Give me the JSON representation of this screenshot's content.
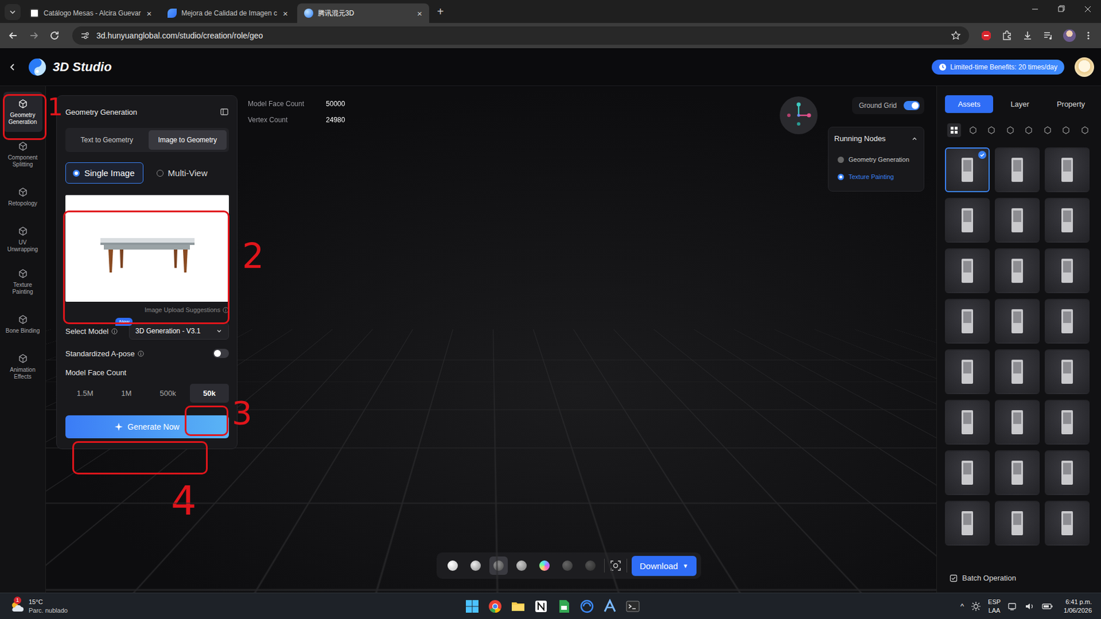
{
  "browser": {
    "tabs": [
      {
        "title": "Catálogo Mesas - Alcira Guevar",
        "close": "×",
        "selected": false
      },
      {
        "title": "Mejora de Calidad de Imagen c",
        "close": "×",
        "selected": false
      },
      {
        "title": "腾讯混元3D",
        "close": "×",
        "selected": true
      }
    ],
    "new_tab": "+",
    "url": "3d.hunyuanglobal.com/studio/creation/role/geo"
  },
  "app": {
    "title": "3D Studio",
    "benefit": "Limited-time Benefits: 20 times/day"
  },
  "tools": [
    {
      "label": "Geometry Generation",
      "selected": true
    },
    {
      "label": "Component Splitting",
      "selected": false
    },
    {
      "label": "Retopology",
      "selected": false
    },
    {
      "label": "UV Unwrapping",
      "selected": false
    },
    {
      "label": "Texture Painting",
      "selected": false
    },
    {
      "label": "Bone Binding",
      "selected": false
    },
    {
      "label": "Animation Effects",
      "selected": false
    }
  ],
  "panel": {
    "title": "Geometry Generation",
    "modes": [
      {
        "label": "Text to Geometry",
        "selected": false
      },
      {
        "label": "Image to Geometry",
        "selected": true
      }
    ],
    "inputs": [
      {
        "label": "Single Image",
        "selected": true
      },
      {
        "label": "Multi-View",
        "selected": false
      }
    ],
    "upload_hint": "Image Upload Suggestions",
    "model": {
      "label": "Select Model",
      "badge": "New",
      "value": "3D Generation - V3.1"
    },
    "apose": {
      "label": "Standardized A-pose",
      "on": false
    },
    "face_count": {
      "label": "Model Face Count",
      "options": [
        {
          "label": "1.5M",
          "selected": false
        },
        {
          "label": "1M",
          "selected": false
        },
        {
          "label": "500k",
          "selected": false
        },
        {
          "label": "50k",
          "selected": true
        }
      ]
    },
    "generate": "Generate Now"
  },
  "stats": [
    {
      "label": "Model Face Count",
      "value": "50000"
    },
    {
      "label": "Vertex Count",
      "value": "24980"
    }
  ],
  "ground_grid": {
    "label": "Ground Grid",
    "on": true
  },
  "running_nodes": {
    "title": "Running Nodes",
    "nodes": [
      {
        "label": "Geometry Generation",
        "active": false
      },
      {
        "label": "Texture Painting",
        "active": true
      }
    ]
  },
  "right_tabs": [
    {
      "label": "Assets",
      "selected": true
    },
    {
      "label": "Layer",
      "selected": false
    },
    {
      "label": "Property",
      "selected": false
    }
  ],
  "asset_filters": [
    {
      "selected": true
    },
    {
      "selected": false
    },
    {
      "selected": false
    },
    {
      "selected": false
    },
    {
      "selected": false
    },
    {
      "selected": false
    },
    {
      "selected": false
    },
    {
      "selected": false
    }
  ],
  "assets": [
    {
      "selected": true
    },
    {
      "selected": false
    },
    {
      "selected": false
    },
    {
      "selected": false
    },
    {
      "selected": false
    },
    {
      "selected": false
    },
    {
      "selected": false
    },
    {
      "selected": false
    },
    {
      "selected": false
    },
    {
      "selected": false
    },
    {
      "selected": false
    },
    {
      "selected": false
    },
    {
      "selected": false
    },
    {
      "selected": false
    },
    {
      "selected": false
    },
    {
      "selected": false
    },
    {
      "selected": false
    },
    {
      "selected": false
    },
    {
      "selected": false
    },
    {
      "selected": false
    },
    {
      "selected": false
    },
    {
      "selected": false
    },
    {
      "selected": false
    },
    {
      "selected": false
    }
  ],
  "batch": "Batch Operation",
  "viewer_toolbar": {
    "modes": [
      {
        "selected": false
      },
      {
        "selected": false
      },
      {
        "selected": true
      },
      {
        "selected": false
      },
      {
        "selected": false
      },
      {
        "selected": false
      },
      {
        "selected": false
      }
    ],
    "download": "Download",
    "caret": "▼"
  },
  "annotations": [
    {
      "label": "1"
    },
    {
      "label": "2"
    },
    {
      "label": "3"
    },
    {
      "label": "4"
    }
  ],
  "taskbar": {
    "weather": {
      "temp": "15°C",
      "desc": "Parc. nublado",
      "badge": "1"
    },
    "tray_arrow": "^",
    "lang": [
      "ESP",
      "LAA"
    ],
    "time": "6:41 p.m.",
    "date": "1/06/2026"
  }
}
